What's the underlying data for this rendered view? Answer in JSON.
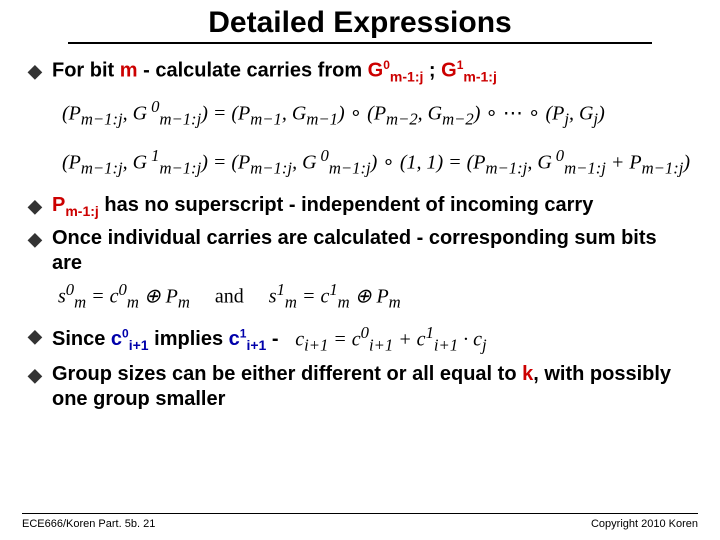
{
  "title": "Detailed Expressions",
  "b1_pre": "For bit ",
  "b1_m": "m",
  "b1_mid": " - calculate carries from ",
  "b1_G": "G",
  "b1_sup0": "0",
  "b1_sub": "m-1:j",
  "b1_sep": " ; ",
  "b1_sup1": "1",
  "eq1_line1": "(P<sub>m−1:j</sub>, G&#8201;<sup>0</sup><sub>m−1:j</sub>) = (P<sub>m−1</sub>, G<sub>m−1</sub>) <span class=\"upright\">∘</span> (P<sub>m−2</sub>, G<sub>m−2</sub>) <span class=\"upright\">∘ ⋯ ∘</span> (P<sub>j</sub>, G<sub>j</sub>)",
  "eq1_line2": "(P<sub>m−1:j</sub>, G&#8201;<sup>1</sup><sub>m−1:j</sub>) = (P<sub>m−1:j</sub>, G&#8201;<sup>0</sup><sub>m−1:j</sub>) <span class=\"upright\">∘</span> (1, 1) = (P<sub>m−1:j</sub>, G&#8201;<sup>0</sup><sub>m−1:j</sub> + P<sub>m−1:j</sub>)",
  "b2_P": "P",
  "b2_sub": "m-1:j",
  "b2_txt": " has no superscript - independent of incoming carry",
  "b3_txt": "Once individual carries are calculated - corresponding sum bits are",
  "eq2": "s<sup>0</sup><sub>m</sub> = c<sup>0</sup><sub>m</sub> ⊕ P<sub>m</sub> &nbsp;&nbsp;&nbsp; <span class=\"upright\">and</span> &nbsp;&nbsp;&nbsp; s<sup>1</sup><sub>m</sub> = c<sup>1</sup><sub>m</sub> ⊕ P<sub>m</sub>",
  "b4_pre": "Since ",
  "b4_c": "c",
  "b4_sup0": "0",
  "b4_sub": "i+1",
  "b4_mid": "   implies ",
  "b4_sup1": "1",
  "b4_dash": "    -",
  "eq3": "c<sub>i+1</sub> = c<sup>0</sup><sub>i+1</sub> + c<sup>1</sup><sub>i+1</sub> · c<sub>j</sub>",
  "b5_pre": "Group sizes can be either different or all equal to ",
  "b5_k": "k",
  "b5_post": ", with possibly one group smaller",
  "footer_left": "ECE666/Koren Part. 5b. 21",
  "footer_right": "Copyright 2010 Koren"
}
